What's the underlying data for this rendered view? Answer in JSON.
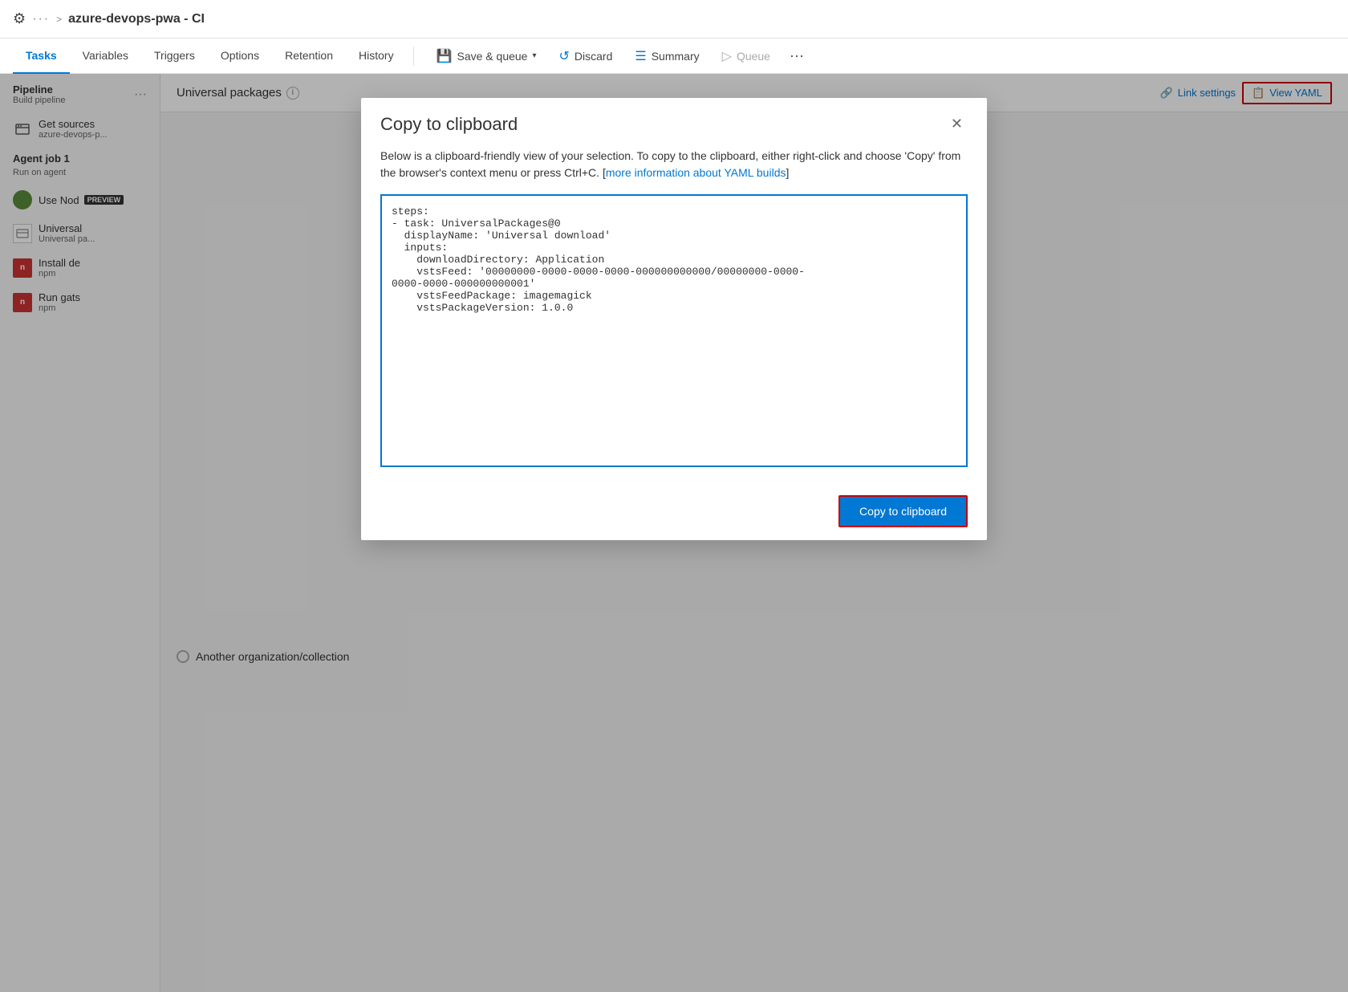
{
  "topbar": {
    "icon": "⚙",
    "dots": "···",
    "chevron": ">",
    "title": "azure-devops-pwa - CI"
  },
  "navtabs": {
    "tabs": [
      {
        "label": "Tasks",
        "active": true
      },
      {
        "label": "Variables",
        "active": false
      },
      {
        "label": "Triggers",
        "active": false
      },
      {
        "label": "Options",
        "active": false
      },
      {
        "label": "Retention",
        "active": false
      },
      {
        "label": "History",
        "active": false
      }
    ],
    "save_queue": "Save & queue",
    "discard": "Discard",
    "summary": "Summary",
    "queue": "Queue"
  },
  "sidebar": {
    "pipeline_title": "Pipeline",
    "pipeline_sub": "Build pipeline",
    "get_sources": "Get sources",
    "get_sources_sub": "azure-devops-p...",
    "agent_job": "Agent job 1",
    "agent_job_sub": "Run on agent",
    "items": [
      {
        "label": "Use Nod",
        "sub": "",
        "icon": "node",
        "preview": true
      },
      {
        "label": "Universal",
        "sub": "Universal pa...",
        "icon": "universal"
      },
      {
        "label": "Install de",
        "sub": "npm",
        "icon": "npm"
      },
      {
        "label": "Run gats",
        "sub": "npm",
        "icon": "npm"
      }
    ]
  },
  "right_panel": {
    "title": "Universal packages",
    "link_settings": "Link settings",
    "view_yaml": "View YAML",
    "radio_label": "Another organization/collection"
  },
  "modal": {
    "title": "Copy to clipboard",
    "desc": "Below is a clipboard-friendly view of your selection. To copy to the clipboard, either right-click and choose 'Copy' from the browser's context menu or press Ctrl+C. [more information about YAML builds]",
    "yaml_content": "steps:\n- task: UniversalPackages@0\n  displayName: 'Universal download'\n  inputs:\n    downloadDirectory: Application\n    vstsFeed: '00000000-0000-0000-0000-000000000000/00000000-0000-\n0000-0000-000000000001'\n    vstsFeedPackage: imagemagick\n    vstsPackageVersion: 1.0.0",
    "copy_button": "Copy to clipboard"
  }
}
